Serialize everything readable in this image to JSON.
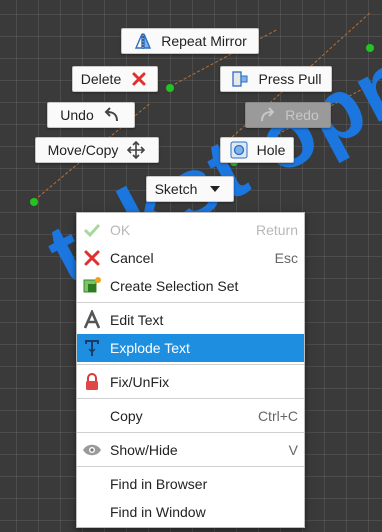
{
  "canvas": {
    "text": "tekst opny"
  },
  "marking_menu": {
    "repeat_mirror": "Repeat Mirror",
    "delete": "Delete",
    "press_pull": "Press Pull",
    "undo": "Undo",
    "redo": "Redo",
    "move_copy": "Move/Copy",
    "hole": "Hole",
    "sketch": "Sketch"
  },
  "context_menu": {
    "ok": {
      "label": "OK",
      "shortcut": "Return"
    },
    "cancel": {
      "label": "Cancel",
      "shortcut": "Esc"
    },
    "create_selection_set": {
      "label": "Create Selection Set"
    },
    "edit_text": {
      "label": "Edit Text"
    },
    "explode_text": {
      "label": "Explode Text"
    },
    "fix_unfix": {
      "label": "Fix/UnFix"
    },
    "copy": {
      "label": "Copy",
      "shortcut": "Ctrl+C"
    },
    "show_hide": {
      "label": "Show/Hide",
      "shortcut": "V"
    },
    "find_in_browser": {
      "label": "Find in Browser"
    },
    "find_in_window": {
      "label": "Find in Window"
    }
  },
  "colors": {
    "highlight": "#1e8fe0",
    "sketch_text": "#1a7be8",
    "point": "#22c422",
    "construction": "#c0702a"
  }
}
